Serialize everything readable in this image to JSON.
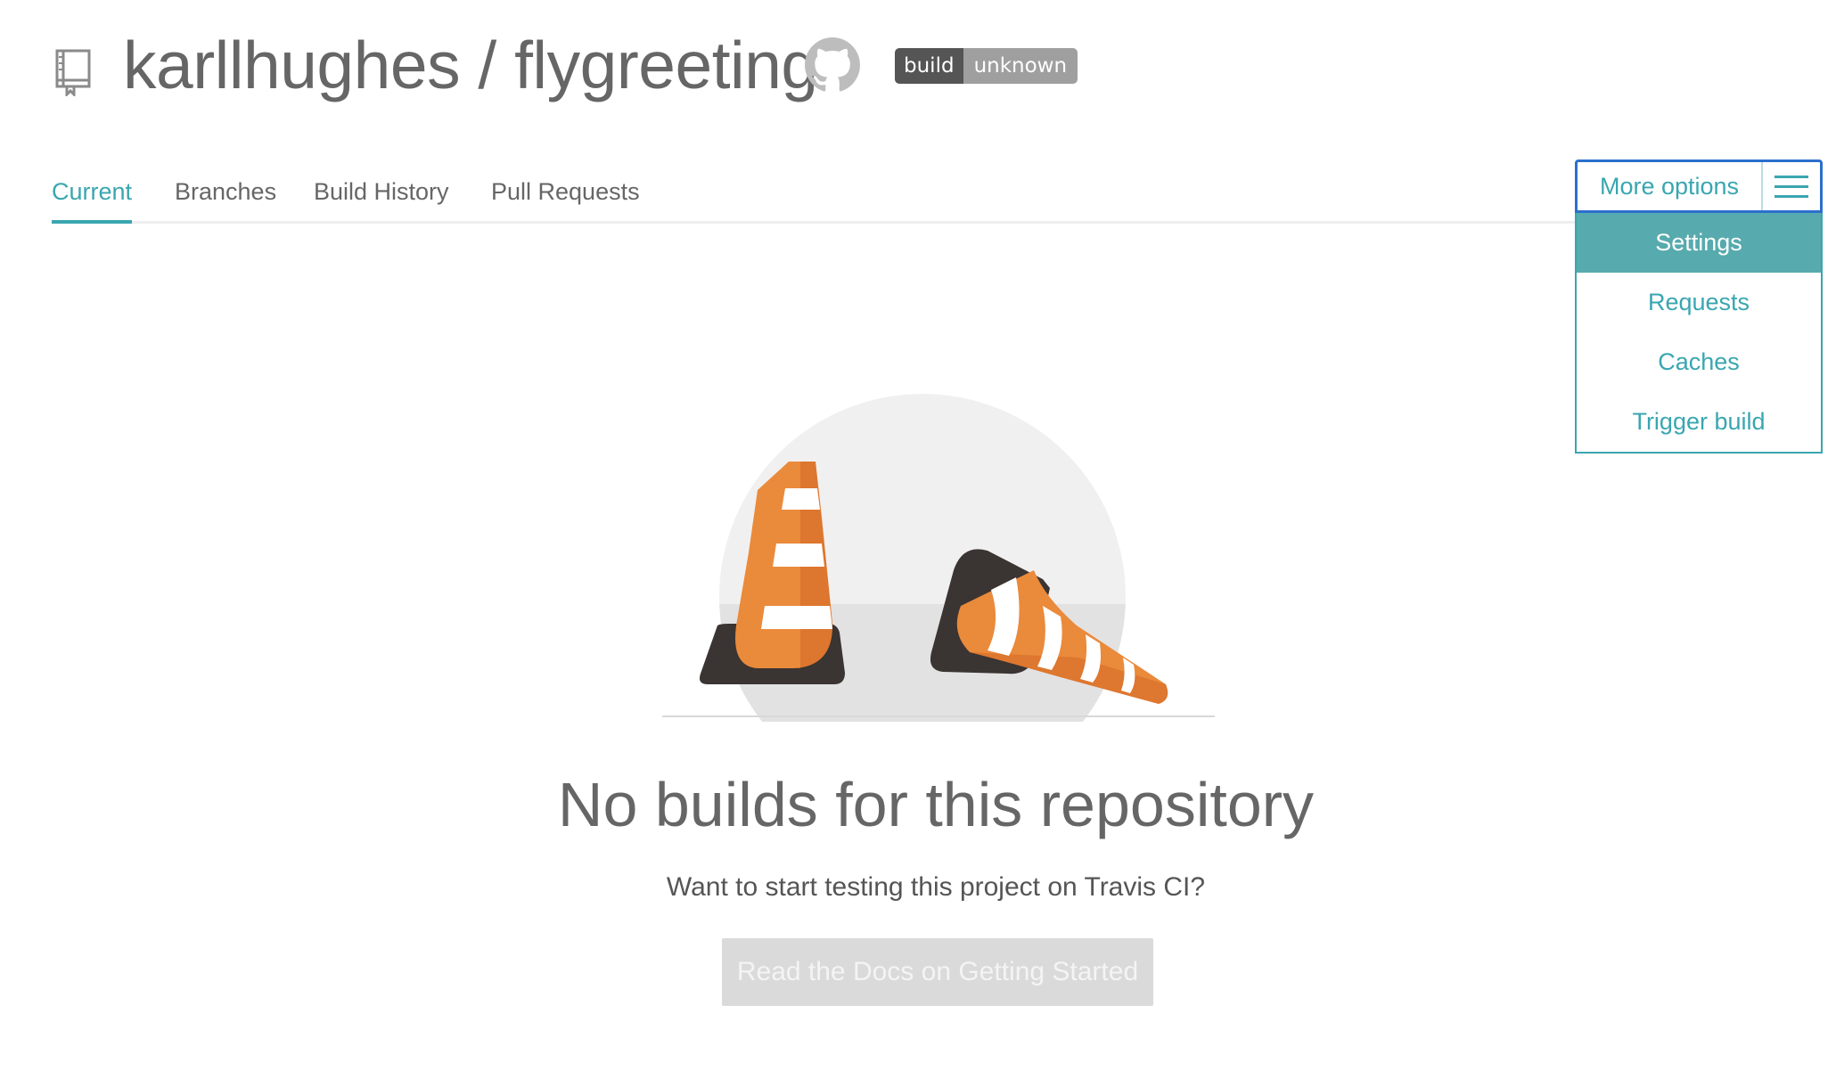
{
  "header": {
    "owner": "karllhughes",
    "separator": " / ",
    "repo": "flygreeting",
    "badge_left": "build",
    "badge_right": "unknown"
  },
  "tabs": [
    {
      "label": "Current",
      "active": true
    },
    {
      "label": "Branches",
      "active": false
    },
    {
      "label": "Build History",
      "active": false
    },
    {
      "label": "Pull Requests",
      "active": false
    }
  ],
  "more_options": {
    "label": "More options",
    "items": [
      {
        "label": "Settings",
        "active": true
      },
      {
        "label": "Requests",
        "active": false
      },
      {
        "label": "Caches",
        "active": false
      },
      {
        "label": "Trigger build",
        "active": false
      }
    ]
  },
  "empty_state": {
    "title": "No builds for this repository",
    "subtitle": "Want to start testing this project on Travis CI?",
    "button": "Read the Docs on Getting Started"
  },
  "colors": {
    "accent": "#39a6b0",
    "menu_active_bg": "#57aaad",
    "focus_border": "#2b6fcc",
    "cone_orange": "#ea8a3b",
    "cone_base": "#3a3432"
  },
  "icons": [
    "repository-icon",
    "github-icon",
    "hamburger-icon",
    "traffic-cone-illustration"
  ]
}
